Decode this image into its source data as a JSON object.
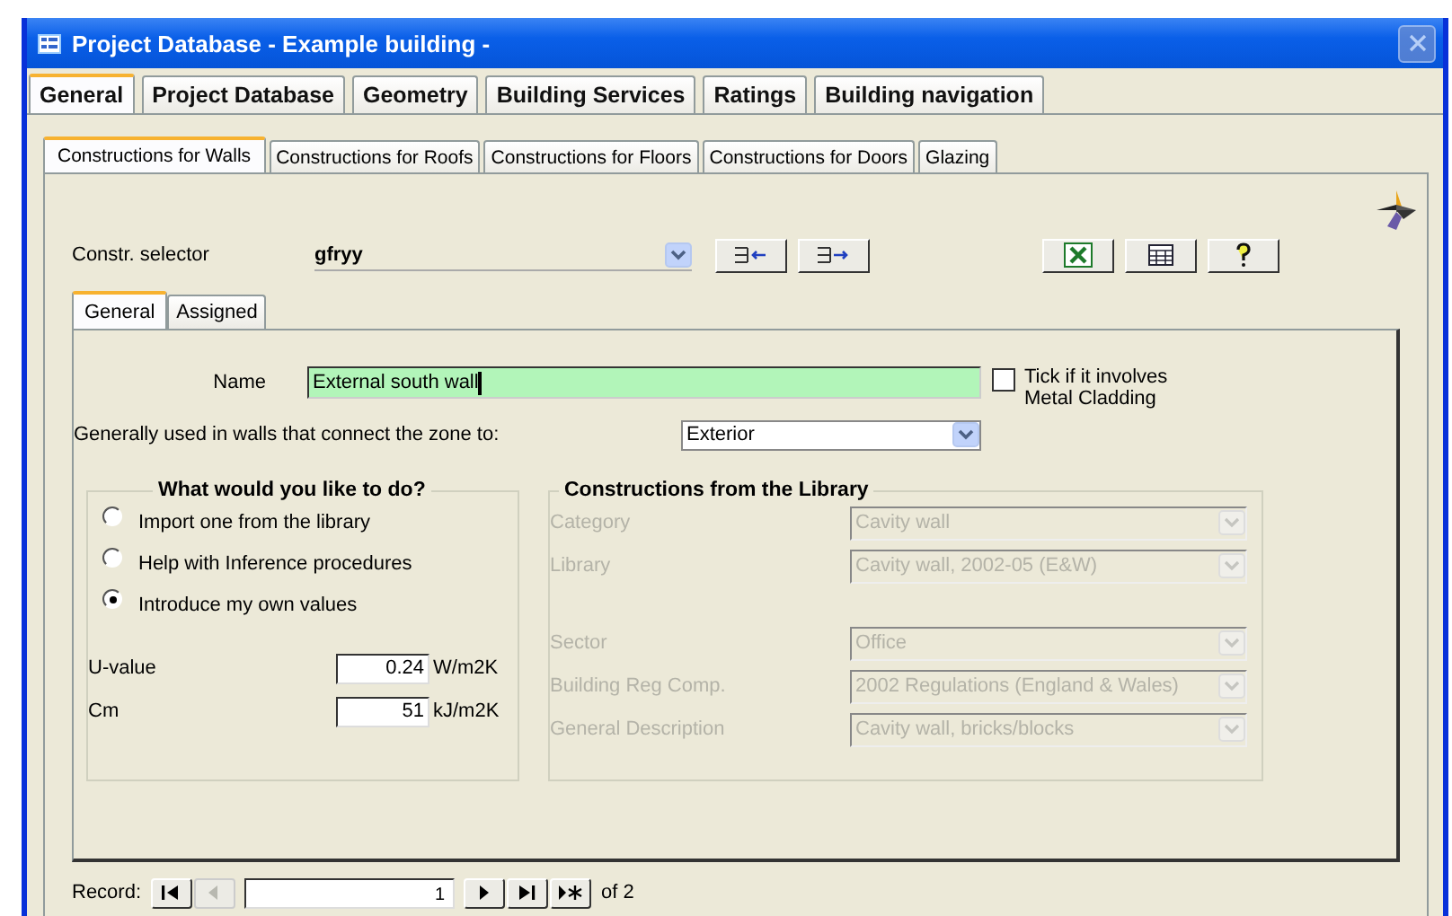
{
  "window": {
    "title": "Project Database - Example building -"
  },
  "main_tabs": [
    {
      "label": "General",
      "selected": true
    },
    {
      "label": "Project Database",
      "selected": false
    },
    {
      "label": "Geometry",
      "selected": false
    },
    {
      "label": "Building Services",
      "selected": false
    },
    {
      "label": "Ratings",
      "selected": false
    },
    {
      "label": "Building navigation",
      "selected": false
    }
  ],
  "sub_tabs": [
    {
      "label": "Constructions for Walls",
      "selected": true
    },
    {
      "label": "Constructions for Roofs",
      "selected": false
    },
    {
      "label": "Constructions for Floors",
      "selected": false
    },
    {
      "label": "Constructions for Doors",
      "selected": false
    },
    {
      "label": "Glazing",
      "selected": false
    }
  ],
  "selector": {
    "label": "Constr. selector",
    "value": "gfryy"
  },
  "inner_tabs": [
    {
      "label": "General",
      "selected": true
    },
    {
      "label": "Assigned",
      "selected": false
    }
  ],
  "name_field": {
    "label": "Name",
    "value": "External south wall"
  },
  "metal_cladding": {
    "label": "Tick if it involves Metal Cladding",
    "checked": false
  },
  "connects_to": {
    "label": "Generally used in walls that connect the zone to:",
    "value": "Exterior"
  },
  "options_group": {
    "title": "What would you like to do?",
    "options": [
      {
        "label": "Import one from the library",
        "selected": false
      },
      {
        "label": "Help with Inference procedures",
        "selected": false
      },
      {
        "label": "Introduce my own values",
        "selected": true
      }
    ]
  },
  "values": [
    {
      "label": "U-value",
      "value": "0.24",
      "unit": "W/m2K"
    },
    {
      "label": "Cm",
      "value": "51",
      "unit": "kJ/m2K"
    }
  ],
  "library_group": {
    "title": "Constructions from the Library",
    "disabled": true,
    "fields": [
      {
        "label": "Category",
        "value": "Cavity wall"
      },
      {
        "label": "Library",
        "value": "Cavity wall, 2002-05 (E&W)"
      },
      {
        "label": "Sector",
        "value": "Office"
      },
      {
        "label": "Building Reg Comp.",
        "value": "2002 Regulations (England & Wales)"
      },
      {
        "label": "General Description",
        "value": "Cavity wall, bricks/blocks"
      }
    ]
  },
  "record_nav": {
    "label": "Record:",
    "current": "1",
    "total": "of 2",
    "buttons": [
      {
        "kind": "first",
        "disabled": false
      },
      {
        "kind": "previous",
        "disabled": true
      },
      {
        "kind": "next",
        "disabled": false
      },
      {
        "kind": "last",
        "disabled": false
      },
      {
        "kind": "new",
        "disabled": false
      }
    ]
  }
}
